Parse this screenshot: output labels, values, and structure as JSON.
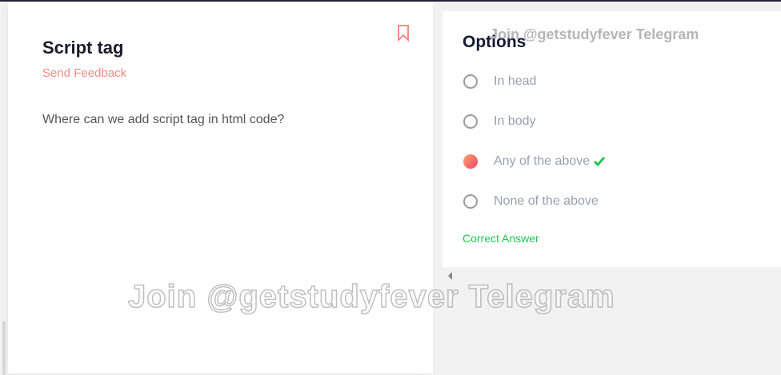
{
  "question": {
    "title": "Script tag",
    "feedback_link": "Send Feedback",
    "text": "Where can we add script tag in html code?"
  },
  "options": {
    "heading": "Options",
    "items": [
      {
        "label": "In head",
        "selected": false
      },
      {
        "label": "In body",
        "selected": false
      },
      {
        "label": "Any of the above",
        "selected": true,
        "correct": true
      },
      {
        "label": "None of the above",
        "selected": false
      }
    ],
    "result": "Correct Answer"
  },
  "watermark": "Join @getstudyfever Telegram",
  "colors": {
    "accent": "#f58a86",
    "correct": "#1fc750",
    "title": "#1b1b2b"
  }
}
